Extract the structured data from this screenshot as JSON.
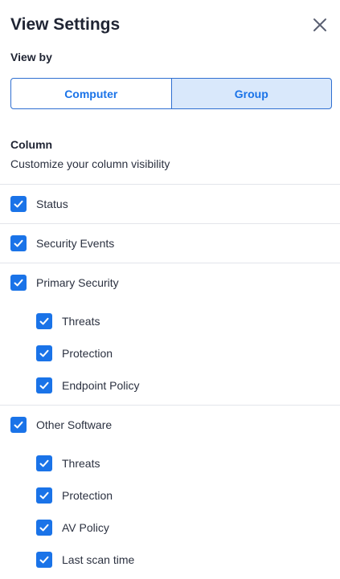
{
  "panel": {
    "title": "View Settings",
    "close_icon": "close-icon"
  },
  "view_by": {
    "label": "View by",
    "options": [
      "Computer",
      "Group"
    ],
    "selected": "Group"
  },
  "column": {
    "label": "Column",
    "description": "Customize your column visibility"
  },
  "groups": [
    {
      "label": "Status",
      "checked": true,
      "children": []
    },
    {
      "label": "Security Events",
      "checked": true,
      "children": []
    },
    {
      "label": "Primary Security",
      "checked": true,
      "children": [
        {
          "label": "Threats",
          "checked": true
        },
        {
          "label": "Protection",
          "checked": true
        },
        {
          "label": "Endpoint Policy",
          "checked": true
        }
      ]
    },
    {
      "label": "Other Software",
      "checked": true,
      "children": [
        {
          "label": "Threats",
          "checked": true
        },
        {
          "label": "Protection",
          "checked": true
        },
        {
          "label": "AV Policy",
          "checked": true
        },
        {
          "label": "Last scan time",
          "checked": true
        }
      ]
    }
  ],
  "colors": {
    "accent": "#1a73e8",
    "selected_bg": "#d9e8fb",
    "divider": "#e3e5ea"
  }
}
